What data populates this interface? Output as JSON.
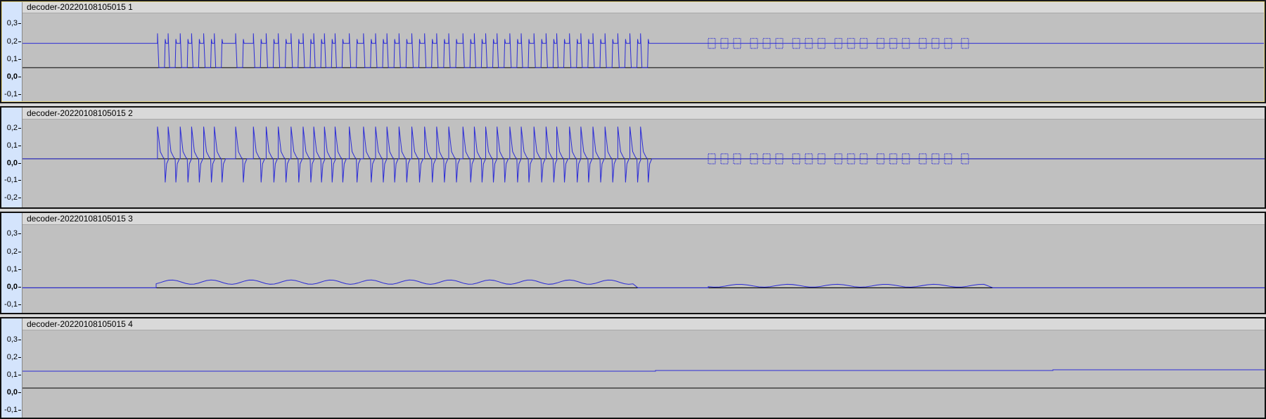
{
  "tracks": [
    {
      "name": "decoder-20220108105015 1",
      "scale": [
        "0,3",
        "0,2",
        "0,1",
        "0,0",
        "-0,1"
      ],
      "zero": "0,0"
    },
    {
      "name": "decoder-20220108105015 2",
      "scale": [
        "0,2",
        "0,1",
        "0,0",
        "-0,1",
        "-0,2"
      ],
      "zero": "0,0"
    },
    {
      "name": "decoder-20220108105015 3",
      "scale": [
        "0,3",
        "0,2",
        "0,1",
        "0,0",
        "-0,1"
      ],
      "zero": "0,0"
    },
    {
      "name": "decoder-20220108105015 4",
      "scale": [
        "0,3",
        "0,2",
        "0,1",
        "0,0",
        "-0,1"
      ],
      "zero": "0,0"
    }
  ],
  "colors": {
    "waveform": "#2b2bd6",
    "plot_bg": "#c0c0c0",
    "zero_line": "#000000",
    "track_control_bg": "#d4e4fc"
  }
}
